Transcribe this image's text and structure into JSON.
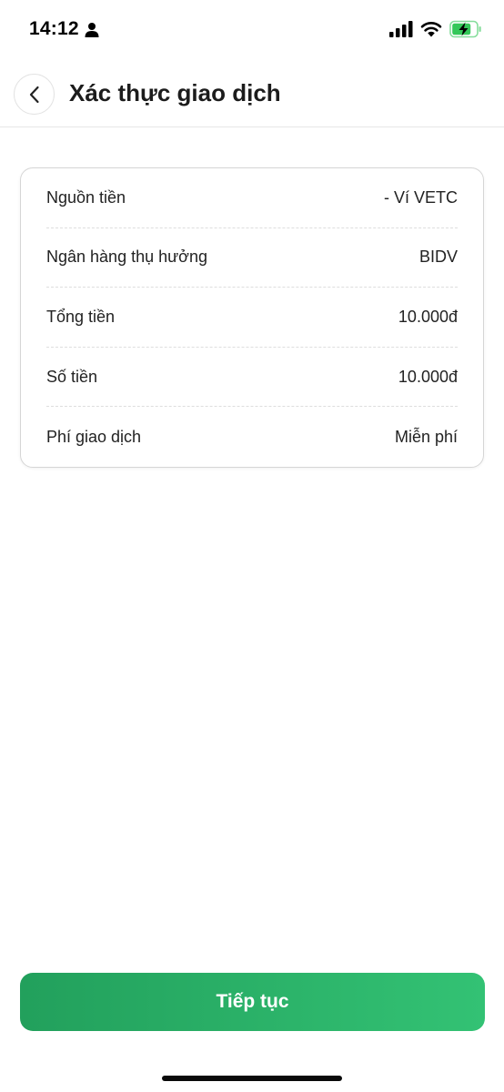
{
  "status_bar": {
    "time": "14:12",
    "icons": [
      "person-icon",
      "signal-icon",
      "wifi-icon",
      "battery-charging-icon"
    ],
    "battery_color": "#34c759"
  },
  "header": {
    "back_icon": "chevron-left-icon",
    "title": "Xác thực giao dịch"
  },
  "details": {
    "rows": [
      {
        "label": "Nguồn tiền",
        "value": "- Ví VETC"
      },
      {
        "label": "Ngân hàng thụ hưởng",
        "value": "BIDV"
      },
      {
        "label": "Tổng tiền",
        "value": "10.000đ"
      },
      {
        "label": "Số tiền",
        "value": "10.000đ"
      },
      {
        "label": "Phí giao dịch",
        "value": "Miễn phí"
      }
    ]
  },
  "footer": {
    "continue_label": "Tiếp tục",
    "button_gradient": [
      "#22a05c",
      "#33c274"
    ]
  }
}
